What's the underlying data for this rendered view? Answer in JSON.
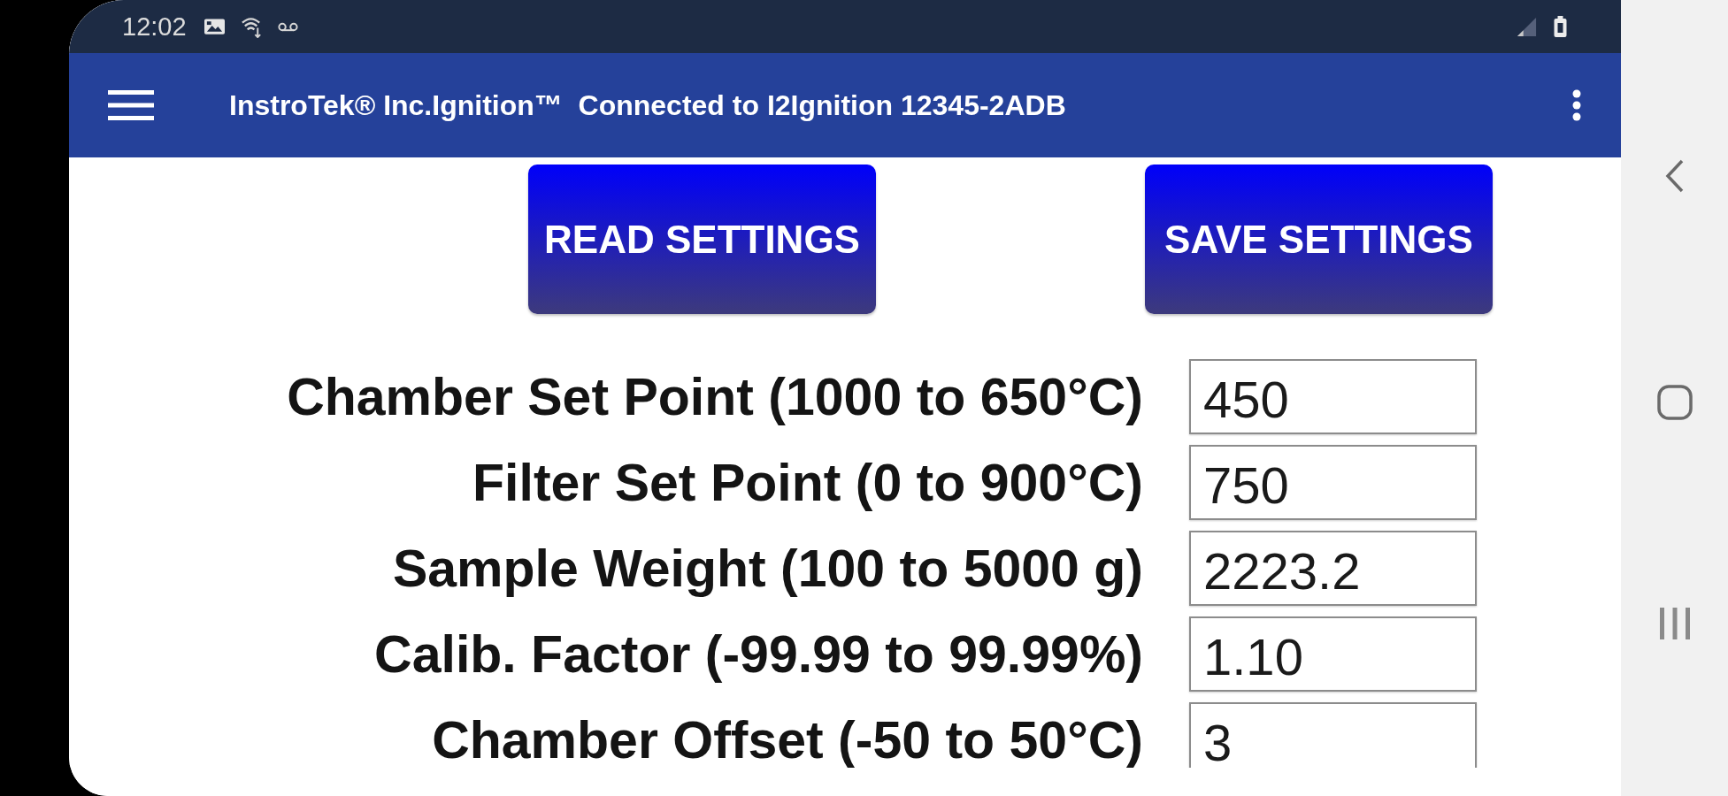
{
  "status_bar": {
    "time": "12:02"
  },
  "app_bar": {
    "title": "InstroTek® Inc.Ignition™  Connected to I2Ignition 12345-2ADB"
  },
  "buttons": [
    {
      "label": "READ SETTINGS"
    },
    {
      "label": "SAVE SETTINGS"
    }
  ],
  "settings": [
    {
      "label": "Chamber Set Point (1000 to 650°C)",
      "value": "450"
    },
    {
      "label": "Filter Set Point (0 to 900°C)",
      "value": "750"
    },
    {
      "label": "Sample Weight (100 to 5000 g)",
      "value": "2223.2"
    },
    {
      "label": "Calib. Factor (-99.99 to 99.99%)",
      "value": "1.10"
    },
    {
      "label": "Chamber Offset (-50 to 50°C)",
      "value": "3"
    }
  ]
}
